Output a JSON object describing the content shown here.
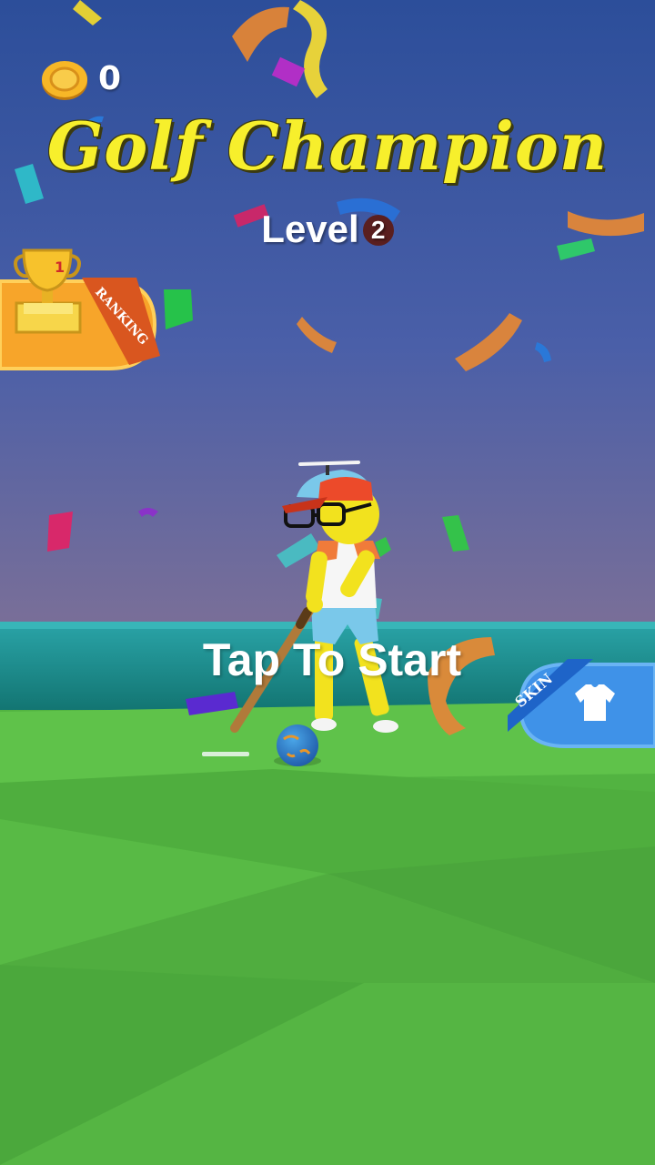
{
  "hud": {
    "coin_icon": "gold-coin-icon",
    "coins": "0"
  },
  "title": "Golf Champion",
  "level": {
    "label": "Level",
    "number": "2"
  },
  "ranking": {
    "label": "RANKING",
    "icon": "trophy-icon",
    "badge": "1"
  },
  "skin": {
    "label": "SKIN",
    "icon": "tshirt-icon"
  },
  "prompt": "Tap To Start",
  "colors": {
    "sky_top": "#2c4e9a",
    "sky_bottom": "#6e6a98",
    "water": "#167a78",
    "grass_light": "#58be44",
    "grass_dark": "#4aa83d",
    "title_yellow": "#f7ef2c",
    "ranking_orange": "#f7a52a",
    "skin_blue": "#3f92e8"
  }
}
